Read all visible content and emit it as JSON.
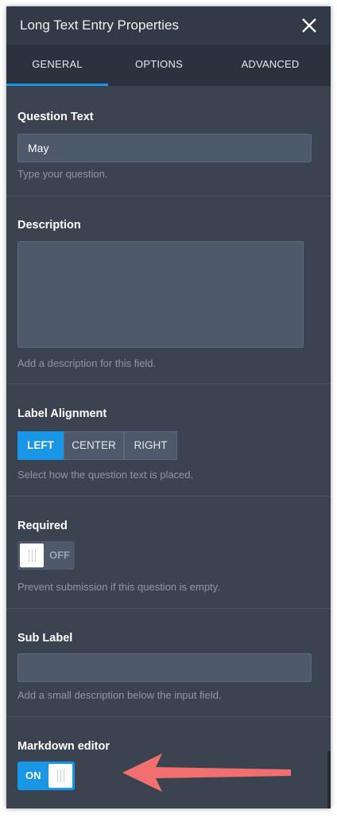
{
  "header": {
    "title": "Long Text Entry Properties"
  },
  "tabs": [
    {
      "label": "GENERAL",
      "active": true
    },
    {
      "label": "OPTIONS",
      "active": false
    },
    {
      "label": "ADVANCED",
      "active": false
    }
  ],
  "question_text": {
    "label": "Question Text",
    "value": "May",
    "hint": "Type your question."
  },
  "description": {
    "label": "Description",
    "value": "",
    "hint": "Add a description for this field."
  },
  "label_alignment": {
    "label": "Label Alignment",
    "options": [
      "LEFT",
      "CENTER",
      "RIGHT"
    ],
    "selected": "LEFT",
    "hint": "Select how the question text is placed."
  },
  "required": {
    "label": "Required",
    "state": "OFF",
    "hint": "Prevent submission if this question is empty."
  },
  "sub_label": {
    "label": "Sub Label",
    "value": "",
    "hint": "Add a small description below the input field."
  },
  "markdown_editor": {
    "label": "Markdown editor",
    "state": "ON"
  },
  "colors": {
    "panel": "#3b4351",
    "accent": "#1a96e6",
    "arrow": "#f26f6f",
    "grammarly": "#15c39a"
  }
}
